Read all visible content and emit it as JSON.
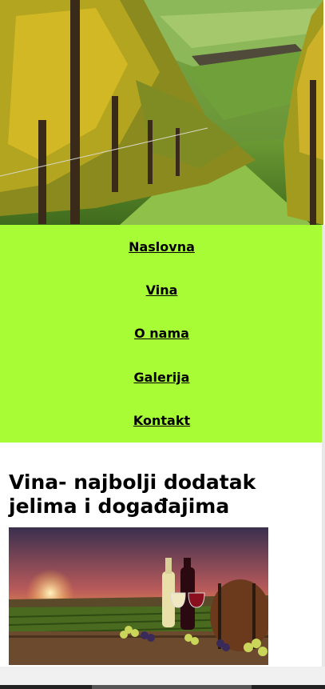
{
  "hero": {
    "image": "vineyard-photo"
  },
  "nav": {
    "items": [
      {
        "label": "Naslovna"
      },
      {
        "label": "Vina"
      },
      {
        "label": "O nama"
      },
      {
        "label": "Galerija"
      },
      {
        "label": "Kontakt"
      }
    ],
    "background": "#a7fc35"
  },
  "content": {
    "heading": "Vina- najbolji dodatak jelima i događajima",
    "image": "wine-sunset-photo"
  }
}
